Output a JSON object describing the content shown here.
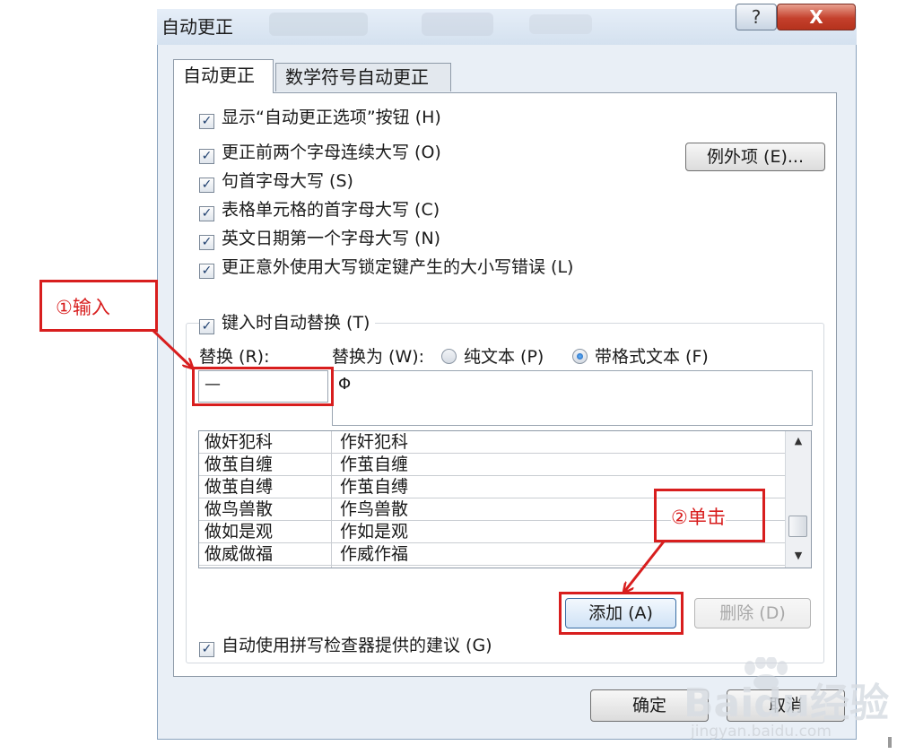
{
  "window": {
    "title": "自动更正",
    "help_label": "?",
    "close_label": "X"
  },
  "tabs": [
    {
      "label": "自动更正",
      "active": true
    },
    {
      "label": "数学符号自动更正",
      "active": false
    }
  ],
  "options": {
    "show_options_button": "显示“自动更正选项”按钮 (H)",
    "correct_two_initials": "更正前两个字母连续大写 (O)",
    "capitalize_sentence": "句首字母大写 (S)",
    "capitalize_table_cell": "表格单元格的首字母大写 (C)",
    "capitalize_day_names": "英文日期第一个字母大写 (N)",
    "correct_caps_lock": "更正意外使用大写锁定键产生的大小写错误 (L)",
    "replace_as_you_type": "键入时自动替换 (T)",
    "use_spelling_suggestions": "自动使用拼写检查器提供的建议 (G)"
  },
  "exceptions_button": "例外项 (E)...",
  "replace_label": "替换 (R):",
  "with_label": "替换为 (W):",
  "radio_plain": "纯文本 (P)",
  "radio_formatted": "带格式文本 (F)",
  "replace_value": "—",
  "with_value": "Φ",
  "list_rows": [
    {
      "from": "做奸犯科",
      "to": "作奸犯科"
    },
    {
      "from": "做茧自缠",
      "to": "作茧自缠"
    },
    {
      "from": "做茧自缚",
      "to": "作茧自缚"
    },
    {
      "from": "做鸟兽散",
      "to": "作鸟兽散"
    },
    {
      "from": "做如是观",
      "to": "作如是观"
    },
    {
      "from": "做威做福",
      "to": "作威作福"
    }
  ],
  "add_button": "添加 (A)",
  "delete_button": "删除 (D)",
  "ok_button": "确定",
  "cancel_button": "取消",
  "annotations": {
    "step1": "①输入",
    "step2": "②单击"
  },
  "watermark": {
    "main": "Baidu经验",
    "sub": "jingyan.baidu.com"
  },
  "colors": {
    "annotation": "#d81e1e",
    "window_bg": "#e9eff6",
    "close_button": "#c4402c"
  }
}
